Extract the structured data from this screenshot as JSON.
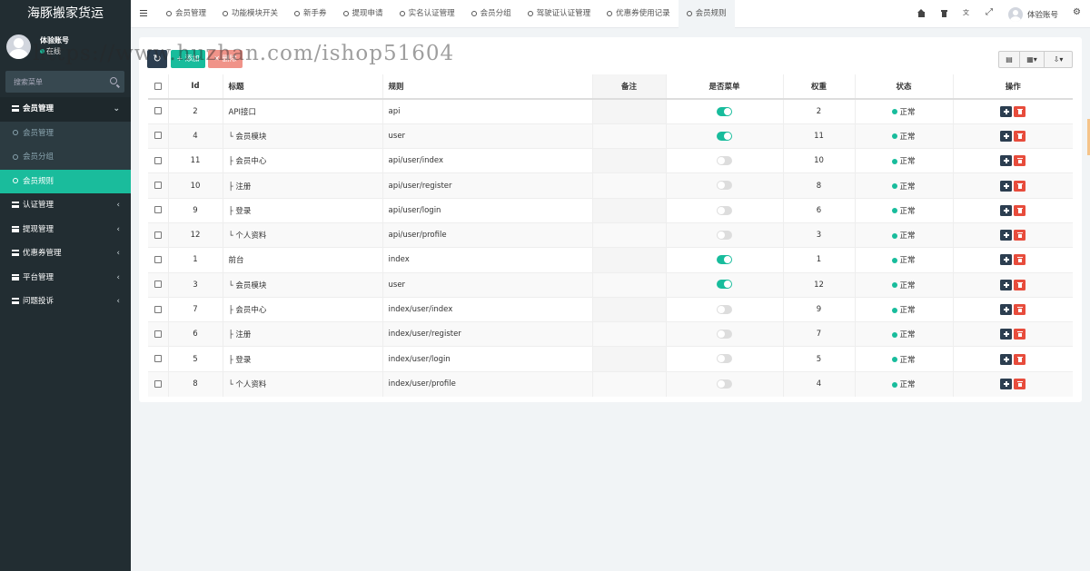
{
  "app": {
    "brand": "海豚搬家货运"
  },
  "user": {
    "name": "体验账号",
    "status": "在线"
  },
  "sidebar": {
    "search_placeholder": "搜索菜单",
    "menu": [
      {
        "label": "会员管理",
        "open": true,
        "children": [
          {
            "label": "会员管理",
            "active": false
          },
          {
            "label": "会员分组",
            "active": false
          },
          {
            "label": "会员规则",
            "active": true
          }
        ]
      },
      {
        "label": "认证管理"
      },
      {
        "label": "提现管理"
      },
      {
        "label": "优惠券管理"
      },
      {
        "label": "平台管理"
      },
      {
        "label": "问题投诉"
      }
    ]
  },
  "topbar": {
    "tabs": [
      {
        "label": "会员管理",
        "active": false
      },
      {
        "label": "功能模块开关",
        "active": false
      },
      {
        "label": "新手券",
        "active": false
      },
      {
        "label": "提现申请",
        "active": false
      },
      {
        "label": "实名认证管理",
        "active": false
      },
      {
        "label": "会员分组",
        "active": false
      },
      {
        "label": "驾驶证认证管理",
        "active": false
      },
      {
        "label": "优惠券使用记录",
        "active": false
      },
      {
        "label": "会员规则",
        "active": true
      }
    ],
    "user_label": "体验账号"
  },
  "toolbar": {
    "add_label": "添加",
    "delete_label": "删除"
  },
  "table": {
    "columns": [
      "Id",
      "标题",
      "规则",
      "备注",
      "是否菜单",
      "权重",
      "状态",
      "操作"
    ],
    "rows": [
      {
        "id": "2",
        "title": "API接口",
        "rule": "api",
        "note": "",
        "menu": true,
        "weigh": "2",
        "status": "正常"
      },
      {
        "id": "4",
        "title": "└ 会员模块",
        "rule": "user",
        "note": "",
        "menu": true,
        "weigh": "11",
        "status": "正常"
      },
      {
        "id": "11",
        "title": "├ 会员中心",
        "rule": "api/user/index",
        "note": "",
        "menu": false,
        "weigh": "10",
        "status": "正常"
      },
      {
        "id": "10",
        "title": "├ 注册",
        "rule": "api/user/register",
        "note": "",
        "menu": false,
        "weigh": "8",
        "status": "正常"
      },
      {
        "id": "9",
        "title": "├ 登录",
        "rule": "api/user/login",
        "note": "",
        "menu": false,
        "weigh": "6",
        "status": "正常"
      },
      {
        "id": "12",
        "title": "└ 个人资料",
        "rule": "api/user/profile",
        "note": "",
        "menu": false,
        "weigh": "3",
        "status": "正常"
      },
      {
        "id": "1",
        "title": "前台",
        "rule": "index",
        "note": "",
        "menu": true,
        "weigh": "1",
        "status": "正常"
      },
      {
        "id": "3",
        "title": "└ 会员模块",
        "rule": "user",
        "note": "",
        "menu": true,
        "weigh": "12",
        "status": "正常"
      },
      {
        "id": "7",
        "title": "├ 会员中心",
        "rule": "index/user/index",
        "note": "",
        "menu": false,
        "weigh": "9",
        "status": "正常"
      },
      {
        "id": "6",
        "title": "├ 注册",
        "rule": "index/user/register",
        "note": "",
        "menu": false,
        "weigh": "7",
        "status": "正常"
      },
      {
        "id": "5",
        "title": "├ 登录",
        "rule": "index/user/login",
        "note": "",
        "menu": false,
        "weigh": "5",
        "status": "正常"
      },
      {
        "id": "8",
        "title": "└ 个人资料",
        "rule": "index/user/profile",
        "note": "",
        "menu": false,
        "weigh": "4",
        "status": "正常"
      }
    ]
  },
  "watermark": "https://www.huzhan.com/ishop51604",
  "colors": {
    "sidebar": "#222d32",
    "accent": "#18bc9c",
    "danger": "#e74c3c",
    "dark_button": "#2c3e50"
  }
}
